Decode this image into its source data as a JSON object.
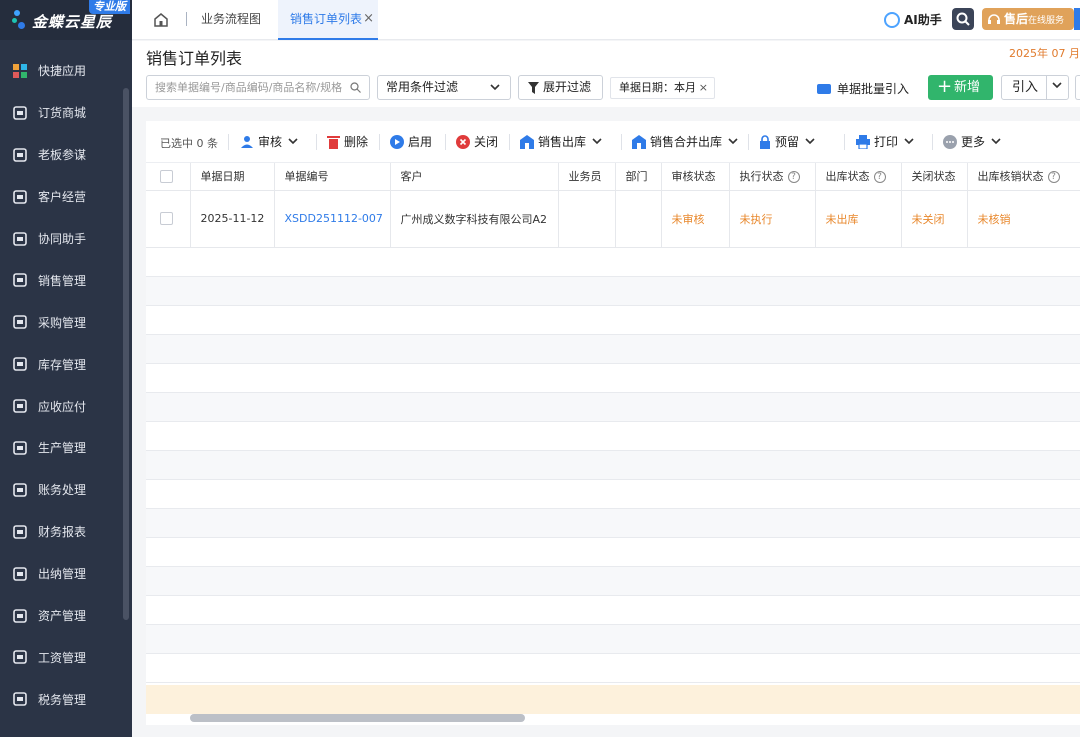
{
  "brand": {
    "name": "金蝶云星辰",
    "badge": "专业版"
  },
  "sidebar": {
    "items": [
      {
        "label": "快捷应用",
        "icon": "apps-icon"
      },
      {
        "label": "订货商城",
        "icon": "shop-icon"
      },
      {
        "label": "老板参谋",
        "icon": "chart-icon"
      },
      {
        "label": "客户经营",
        "icon": "customer-icon"
      },
      {
        "label": "协同助手",
        "icon": "assistant-icon"
      },
      {
        "label": "销售管理",
        "icon": "sales-icon"
      },
      {
        "label": "采购管理",
        "icon": "cart-icon"
      },
      {
        "label": "库存管理",
        "icon": "box-icon"
      },
      {
        "label": "应收应付",
        "icon": "finance-icon"
      },
      {
        "label": "生产管理",
        "icon": "factory-icon"
      },
      {
        "label": "账务处理",
        "icon": "ledger-icon"
      },
      {
        "label": "财务报表",
        "icon": "report-icon"
      },
      {
        "label": "出纳管理",
        "icon": "cashier-icon"
      },
      {
        "label": "资产管理",
        "icon": "asset-icon"
      },
      {
        "label": "工资管理",
        "icon": "payroll-icon"
      },
      {
        "label": "税务管理",
        "icon": "tax-icon"
      }
    ]
  },
  "tabs": {
    "flow": "业务流程图",
    "active": "销售订单列表",
    "close": "×"
  },
  "topbar": {
    "ai_label": "AI助手",
    "service_label": "售后",
    "service_sub": "在线服务"
  },
  "page": {
    "title": "销售订单列表",
    "date_corner": "2025年 07 月",
    "search_placeholder": "搜索单据编号/商品编码/商品名称/规格",
    "filter_select": "常用条件过滤",
    "expand_filter": "展开过滤",
    "chip": "单据日期：本月",
    "chip_close": "×",
    "bulk_import": "单据批量引入",
    "new_label": "新增",
    "import_label": "引入"
  },
  "toolbar": {
    "selected": "已选中 0 条",
    "audit": "审核",
    "delete": "删除",
    "enable": "启用",
    "close": "关闭",
    "sales_out": "销售出库",
    "merge_out": "销售合并出库",
    "reserve": "预留",
    "print": "打印",
    "more": "更多"
  },
  "table": {
    "headers": [
      "单据日期",
      "单据编号",
      "客户",
      "业务员",
      "部门",
      "审核状态",
      "执行状态",
      "出库状态",
      "关闭状态",
      "出库核销状态"
    ],
    "rows": [
      {
        "date": "2025-11-12",
        "number": "XSDD251112-007",
        "customer": "广州成义数字科技有限公司A2",
        "salesman": "",
        "dept": "",
        "audit_status": "未审核",
        "exec_status": "未执行",
        "out_status": "未出库",
        "close_status": "未关闭",
        "verify_status": "未核销"
      }
    ]
  },
  "colors": {
    "accent": "#2f7be8",
    "green": "#31b56c",
    "orange": "#e8872b",
    "sidebar": "#2b3446"
  }
}
